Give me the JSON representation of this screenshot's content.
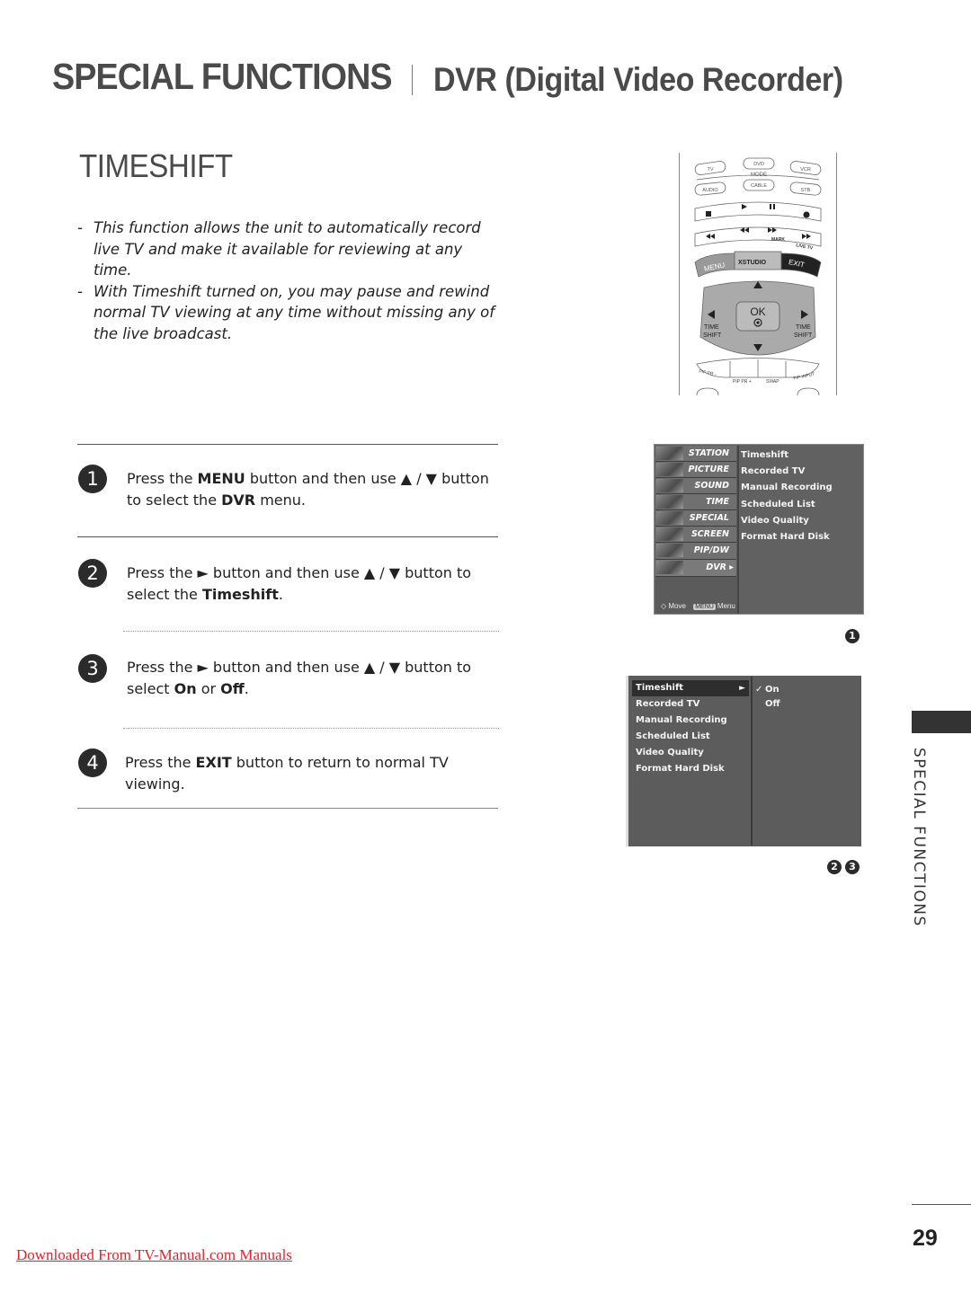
{
  "header": {
    "title": "SPECIAL FUNCTIONS",
    "subtitle": "DVR (Digital Video Recorder)"
  },
  "section": {
    "title": "TIMESHIFT",
    "intro_bullets": [
      "This function allows the unit to automatically record live TV and make it available for reviewing at any time.",
      "With Timeshift turned on, you may pause and rewind normal TV viewing at any time without missing any of the live broadcast."
    ]
  },
  "remote": {
    "mode_buttons": [
      "TV",
      "DVD",
      "VCR",
      "AUDIO",
      "CABLE",
      "STB"
    ],
    "mode_label": "MODE",
    "transport_icons": [
      "stop-icon",
      "play-icon",
      "pause-icon",
      "record-icon",
      "skip-back-icon",
      "rewind-icon",
      "fast-forward-icon",
      "skip-forward-icon"
    ],
    "mark_label": "MARK",
    "live_tv_label": "LIVE TV",
    "menu_label": "MENU",
    "xstudio_label": "XSTUDIO",
    "exit_label": "EXIT",
    "ok_label": "OK",
    "time_shift_left": "TIME SHIFT",
    "time_shift_right": "TIME SHIFT",
    "pip_labels": [
      "PIP PR -",
      "PIP PR +",
      "SWAP",
      "PIP INPUT"
    ]
  },
  "steps": [
    {
      "num": "1",
      "parts": [
        {
          "t": "Press the "
        },
        {
          "b": "MENU"
        },
        {
          "t": " button and  then use ▲ / ▼ button to select the "
        },
        {
          "b": "DVR"
        },
        {
          "t": " menu."
        }
      ]
    },
    {
      "num": "2",
      "parts": [
        {
          "t": "Press the ► button and then use ▲ / ▼ button to select the "
        },
        {
          "b": "Timeshift"
        },
        {
          "t": "."
        }
      ]
    },
    {
      "num": "3",
      "parts": [
        {
          "t": "Press the ► button and then use ▲ / ▼ button to select "
        },
        {
          "b": "On"
        },
        {
          "t": " or "
        },
        {
          "b": "Off"
        },
        {
          "t": "."
        }
      ]
    },
    {
      "num": "4",
      "parts": [
        {
          "t": "Press the "
        },
        {
          "b": "EXIT"
        },
        {
          "t": " button to return to normal TV viewing."
        }
      ]
    }
  ],
  "menu1": {
    "categories": [
      "STATION",
      "PICTURE",
      "SOUND",
      "TIME",
      "SPECIAL",
      "SCREEN",
      "PIP/DW",
      "DVR ▸"
    ],
    "selected_category": "DVR",
    "items": [
      "Timeshift",
      "Recorded TV",
      "Manual Recording",
      "Scheduled List",
      "Video Quality",
      "Format Hard Disk"
    ],
    "footer_move": "Move",
    "footer_key": "MENU",
    "footer_menu": "Menu",
    "marker": "1"
  },
  "menu2": {
    "items": [
      "Timeshift",
      "Recorded TV",
      "Manual Recording",
      "Scheduled List",
      "Video Quality",
      "Format Hard Disk"
    ],
    "selected_item": "Timeshift",
    "options": [
      "On",
      "Off"
    ],
    "checked_option": "On",
    "markers": [
      "2",
      "3"
    ]
  },
  "side_tab": {
    "label": "SPECIAL FUNCTIONS"
  },
  "footer": {
    "page_number": "29",
    "download_link": "Downloaded From TV-Manual.com Manuals"
  }
}
